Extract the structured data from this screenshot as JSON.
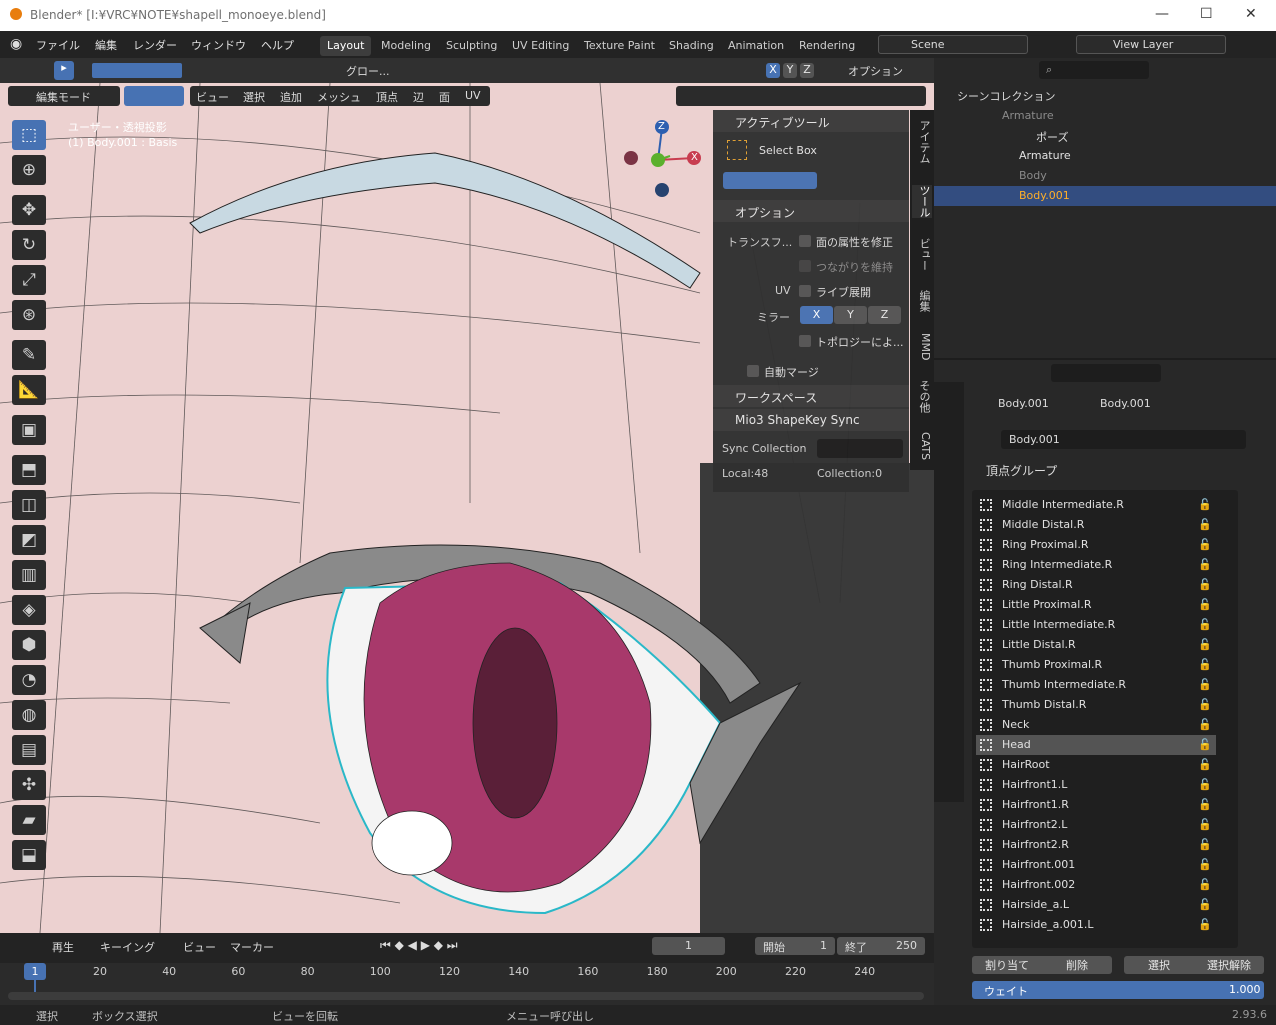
{
  "title": "Blender* [I:¥VRC¥NOTE¥shapell_monoeye.blend]",
  "menu": [
    "ファイル",
    "編集",
    "レンダー",
    "ウィンドウ",
    "ヘルプ"
  ],
  "workspaces": [
    "Layout",
    "Modeling",
    "Sculpting",
    "UV Editing",
    "Texture Paint",
    "Shading",
    "Animation",
    "Rendering"
  ],
  "scene": "Scene",
  "view_layer": "View Layer",
  "header": {
    "orientation": "グロー...",
    "options": "オプション",
    "axes": [
      "X",
      "Y",
      "Z"
    ],
    "mode": "編集モード",
    "view_menus": [
      "ビュー",
      "選択",
      "追加",
      "メッシュ",
      "頂点",
      "辺",
      "面",
      "UV"
    ]
  },
  "viewport": {
    "overlay_line1": "ユーザー・透視投影",
    "overlay_line2": "(1) Body.001 : Basis",
    "gizmo": [
      "Z",
      "X"
    ]
  },
  "npanel": {
    "active_tool_header": "アクティブツール",
    "tool_name": "Select Box",
    "options_header": "オプション",
    "transform_label": "トランスフ...",
    "correct_face": "面の属性を修正",
    "keep_connected": "つながりを維持",
    "uv_label": "UV",
    "live_unwrap": "ライブ展開",
    "mirror_label": "ミラー",
    "mirror_axes": [
      "X",
      "Y",
      "Z"
    ],
    "topology": "トポロジーによ...",
    "auto_merge": "自動マージ",
    "workspace_header": "ワークスペース",
    "mio_header": "Mio3 ShapeKey Sync",
    "sync_collection": "Sync Collection",
    "local": "Local:48",
    "collection": "Collection:0"
  },
  "side_tabs": [
    "アイテム",
    "ツール",
    "ビュー",
    "編集",
    "MMD",
    "その他",
    "CATS"
  ],
  "outliner": {
    "root": "シーンコレクション",
    "items": [
      {
        "label": "Armature",
        "indent": 0,
        "dim": true
      },
      {
        "label": "ポーズ",
        "indent": 2,
        "dim": false
      },
      {
        "label": "Armature",
        "indent": 1,
        "dim": false
      },
      {
        "label": "Body",
        "indent": 1,
        "dim": true
      },
      {
        "label": "Body.001",
        "indent": 1,
        "dim": false,
        "selected": true
      }
    ]
  },
  "properties": {
    "breadcrumb_object": "Body.001",
    "breadcrumb_mesh": "Body.001",
    "mesh_name": "Body.001",
    "vertex_groups_header": "頂点グループ",
    "groups": [
      "Middle Intermediate.R",
      "Middle Distal.R",
      "Ring Proximal.R",
      "Ring Intermediate.R",
      "Ring Distal.R",
      "Little Proximal.R",
      "Little Intermediate.R",
      "Little Distal.R",
      "Thumb Proximal.R",
      "Thumb Intermediate.R",
      "Thumb Distal.R",
      "Neck",
      "Head",
      "HairRoot",
      "Hairfront1.L",
      "Hairfront1.R",
      "Hairfront2.L",
      "Hairfront2.R",
      "Hairfront.001",
      "Hairfront.002",
      "Hairside_a.L",
      "Hairside_a.001.L"
    ],
    "selected_group": "Head",
    "assign": "割り当て",
    "remove": "削除",
    "select": "選択",
    "deselect": "選択解除",
    "weight_label": "ウェイト",
    "weight_value": "1.000"
  },
  "timeline": {
    "playback": "再生",
    "keying": "キーイング",
    "view": "ビュー",
    "marker": "マーカー",
    "current_frame": "1",
    "start_label": "開始",
    "start": "1",
    "end_label": "終了",
    "end": "250",
    "ruler": [
      "20",
      "40",
      "60",
      "80",
      "100",
      "120",
      "140",
      "160",
      "180",
      "200",
      "220",
      "240"
    ],
    "playhead": "1"
  },
  "status": {
    "select": "選択",
    "box_select": "ボックス選択",
    "rotate_view": "ビューを回転",
    "call_menu": "メニュー呼び出し",
    "version": "2.93.6"
  }
}
